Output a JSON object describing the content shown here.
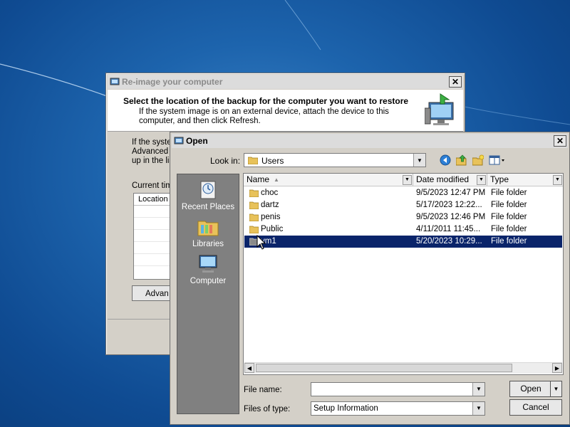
{
  "reimage_dialog": {
    "title": "Re-image your computer",
    "heading": "Select the location of the backup for the computer you want to restore",
    "subtext": "If the system image is on an external device, attach the device to this computer, and then click Refresh.",
    "body_lines": [
      "If the syste",
      "Advanced",
      "up in the lis"
    ],
    "current_label": "Current tim",
    "list_header": "Location",
    "advanced_button": "Advan"
  },
  "open_dialog": {
    "title": "Open",
    "look_in_label": "Look in:",
    "look_in_value": "Users",
    "toolbar_icons": [
      "back-icon",
      "up-folder-icon",
      "new-folder-icon",
      "view-menu-icon"
    ],
    "places": [
      {
        "label": "Recent Places",
        "icon": "recent-places-icon"
      },
      {
        "label": "Libraries",
        "icon": "libraries-icon"
      },
      {
        "label": "Computer",
        "icon": "computer-icon"
      }
    ],
    "columns": [
      "Name",
      "Date modified",
      "Type"
    ],
    "files": [
      {
        "name": "choc",
        "date": "9/5/2023 12:47 PM",
        "type": "File folder",
        "selected": false
      },
      {
        "name": "dartz",
        "date": "5/17/2023 12:22...",
        "type": "File folder",
        "selected": false
      },
      {
        "name": "penis",
        "date": "9/5/2023 12:46 PM",
        "type": "File folder",
        "selected": false
      },
      {
        "name": "Public",
        "date": "4/11/2011 11:45...",
        "type": "File folder",
        "selected": false
      },
      {
        "name": "vm1",
        "date": "5/20/2023 10:29...",
        "type": "File folder",
        "selected": true
      }
    ],
    "file_name_label": "File name:",
    "file_name_value": "",
    "file_type_label": "Files of type:",
    "file_type_value": "Setup Information",
    "open_button": "Open",
    "cancel_button": "Cancel"
  },
  "colors": {
    "desktop": "#1d64ad",
    "selection": "#0a246a",
    "dialog_face": "#d4d0c8"
  }
}
